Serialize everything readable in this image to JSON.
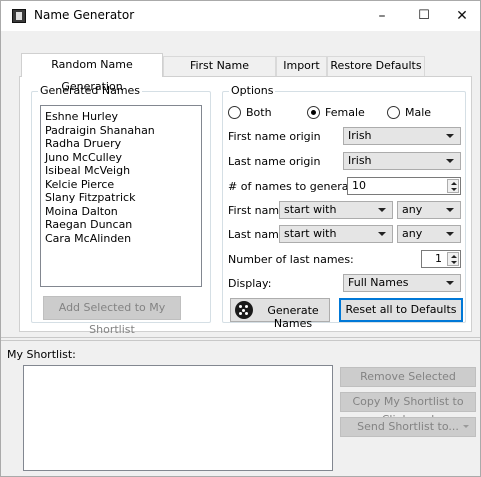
{
  "window": {
    "title": "Name Generator",
    "minimize_glyph": "–",
    "maximize_glyph": "☐",
    "close_glyph": "✕"
  },
  "tabs": [
    {
      "label": "Random Name Generation",
      "active": true
    },
    {
      "label": "First Name Meanings",
      "active": false
    },
    {
      "label": "Import",
      "active": false
    },
    {
      "label": "Restore Defaults",
      "active": false
    }
  ],
  "generated_names": {
    "legend": "Generated Names",
    "items": [
      "Eshne Hurley",
      "Padraigin Shanahan",
      "Radha Druery",
      "Juno McCulley",
      "Isibeal McVeigh",
      "Kelcie Pierce",
      "Slany Fitzpatrick",
      "Moina Dalton",
      "Raegan Duncan",
      "Cara McAlinden"
    ],
    "add_button": "Add Selected to My Shortlist"
  },
  "options": {
    "legend": "Options",
    "gender": {
      "both_label": "Both",
      "female_label": "Female",
      "male_label": "Male",
      "selected": "Female"
    },
    "first_origin_label": "First name origin",
    "first_origin_value": "Irish",
    "last_origin_label": "Last name origin",
    "last_origin_value": "Irish",
    "count_label": "# of names to generate:",
    "count_value": "10",
    "first_name_label": "First name:",
    "first_name_mode": "start with",
    "first_name_letter": "any",
    "last_name_label": "Last name:",
    "last_name_mode": "start with",
    "last_name_letter": "any",
    "num_last_label": "Number of last names:",
    "num_last_value": "1",
    "display_label": "Display:",
    "display_value": "Full Names",
    "generate_button": "Generate Names",
    "reset_button": "Reset all to Defaults"
  },
  "shortlist": {
    "label": "My Shortlist:",
    "remove_button": "Remove Selected",
    "copy_button": "Copy My Shortlist to Clipboard",
    "send_button": "Send Shortlist to..."
  },
  "colors": {
    "focus_border": "#0078d7",
    "disabled_button_bg": "#cccccc",
    "disabled_text": "#838383"
  },
  "icons": {
    "app": "app-icon",
    "generate": "dice-icon"
  }
}
